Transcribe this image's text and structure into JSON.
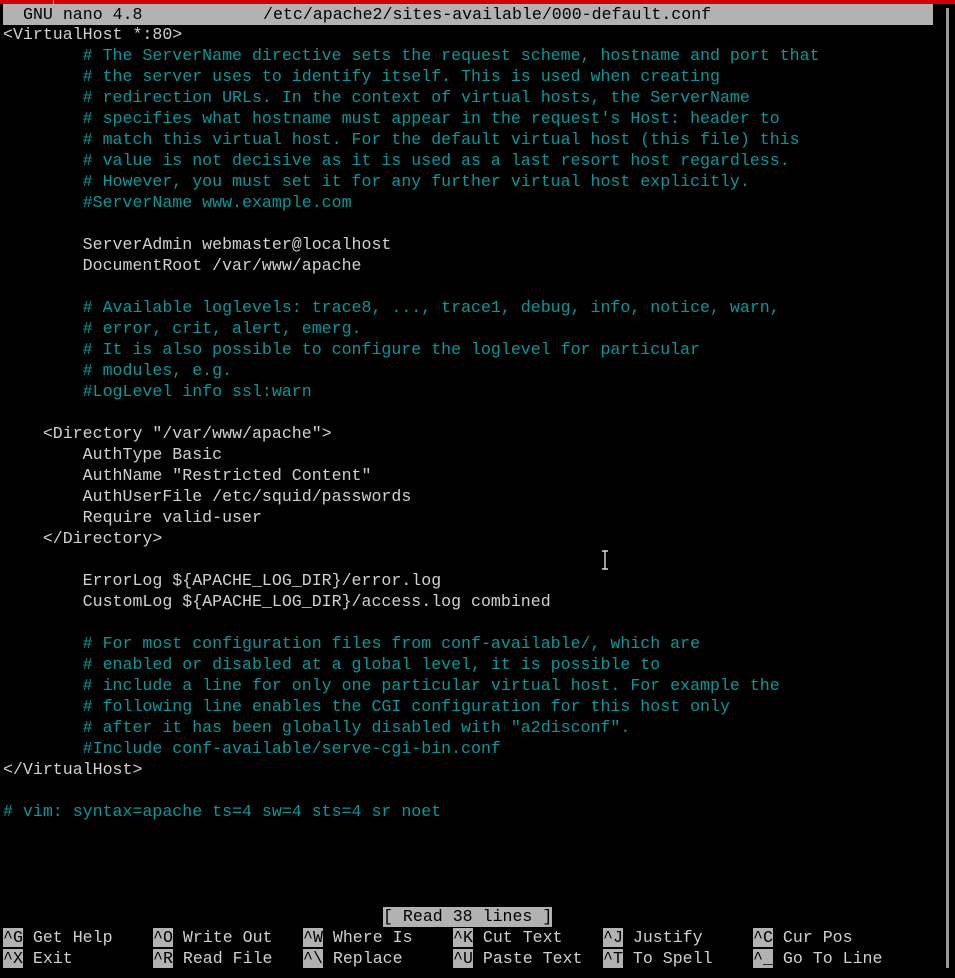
{
  "titlebar": {
    "app_version": "GNU nano 4.8",
    "file_path": "/etc/apache2/sites-available/000-default.conf"
  },
  "colors": {
    "background": "#000000",
    "text": "#d0d0d0",
    "comment": "#06989a",
    "bar_background": "#b2b2b2",
    "bar_text": "#000000",
    "top_strip": "#d00000"
  },
  "editor": {
    "lines": [
      {
        "text": "<VirtualHost *:80>",
        "type": "code"
      },
      {
        "text": "        # The ServerName directive sets the request scheme, hostname and port that",
        "type": "comment"
      },
      {
        "text": "        # the server uses to identify itself. This is used when creating",
        "type": "comment"
      },
      {
        "text": "        # redirection URLs. In the context of virtual hosts, the ServerName",
        "type": "comment"
      },
      {
        "text": "        # specifies what hostname must appear in the request's Host: header to",
        "type": "comment"
      },
      {
        "text": "        # match this virtual host. For the default virtual host (this file) this",
        "type": "comment"
      },
      {
        "text": "        # value is not decisive as it is used as a last resort host regardless.",
        "type": "comment"
      },
      {
        "text": "        # However, you must set it for any further virtual host explicitly.",
        "type": "comment"
      },
      {
        "text": "        #ServerName www.example.com",
        "type": "comment"
      },
      {
        "text": "",
        "type": "code"
      },
      {
        "text": "        ServerAdmin webmaster@localhost",
        "type": "code"
      },
      {
        "text": "        DocumentRoot /var/www/apache",
        "type": "code"
      },
      {
        "text": "",
        "type": "code"
      },
      {
        "text": "        # Available loglevels: trace8, ..., trace1, debug, info, notice, warn,",
        "type": "comment"
      },
      {
        "text": "        # error, crit, alert, emerg.",
        "type": "comment"
      },
      {
        "text": "        # It is also possible to configure the loglevel for particular",
        "type": "comment"
      },
      {
        "text": "        # modules, e.g.",
        "type": "comment"
      },
      {
        "text": "        #LogLevel info ssl:warn",
        "type": "comment"
      },
      {
        "text": "",
        "type": "code"
      },
      {
        "text": "    <Directory \"/var/www/apache\">",
        "type": "code"
      },
      {
        "text": "        AuthType Basic",
        "type": "code"
      },
      {
        "text": "        AuthName \"Restricted Content\"",
        "type": "code"
      },
      {
        "text": "        AuthUserFile /etc/squid/passwords",
        "type": "code"
      },
      {
        "text": "        Require valid-user",
        "type": "code"
      },
      {
        "text": "    </Directory>",
        "type": "code"
      },
      {
        "text": "",
        "type": "code"
      },
      {
        "text": "        ErrorLog ${APACHE_LOG_DIR}/error.log",
        "type": "code"
      },
      {
        "text": "        CustomLog ${APACHE_LOG_DIR}/access.log combined",
        "type": "code"
      },
      {
        "text": "",
        "type": "code"
      },
      {
        "text": "        # For most configuration files from conf-available/, which are",
        "type": "comment"
      },
      {
        "text": "        # enabled or disabled at a global level, it is possible to",
        "type": "comment"
      },
      {
        "text": "        # include a line for only one particular virtual host. For example the",
        "type": "comment"
      },
      {
        "text": "        # following line enables the CGI configuration for this host only",
        "type": "comment"
      },
      {
        "text": "        # after it has been globally disabled with \"a2disconf\".",
        "type": "comment"
      },
      {
        "text": "        #Include conf-available/serve-cgi-bin.conf",
        "type": "comment"
      },
      {
        "text": "</VirtualHost>",
        "type": "code"
      },
      {
        "text": "",
        "type": "code"
      },
      {
        "text": "# vim: syntax=apache ts=4 sw=4 sts=4 sr noet",
        "type": "comment"
      }
    ]
  },
  "status": {
    "message": "[ Read 38 lines ]"
  },
  "shortcuts": {
    "row1": [
      {
        "key": "^G",
        "label": "Get Help",
        "name": "get-help"
      },
      {
        "key": "^O",
        "label": "Write Out",
        "name": "write-out"
      },
      {
        "key": "^W",
        "label": "Where Is",
        "name": "where-is"
      },
      {
        "key": "^K",
        "label": "Cut Text",
        "name": "cut-text"
      },
      {
        "key": "^J",
        "label": "Justify",
        "name": "justify"
      },
      {
        "key": "^C",
        "label": "Cur Pos",
        "name": "cur-pos"
      }
    ],
    "row2": [
      {
        "key": "^X",
        "label": "Exit",
        "name": "exit"
      },
      {
        "key": "^R",
        "label": "Read File",
        "name": "read-file"
      },
      {
        "key": "^\\",
        "label": "Replace",
        "name": "replace"
      },
      {
        "key": "^U",
        "label": "Paste Text",
        "name": "paste-text"
      },
      {
        "key": "^T",
        "label": "To Spell",
        "name": "to-spell"
      },
      {
        "key": "^_",
        "label": "Go To Line",
        "name": "go-to-line"
      }
    ]
  }
}
